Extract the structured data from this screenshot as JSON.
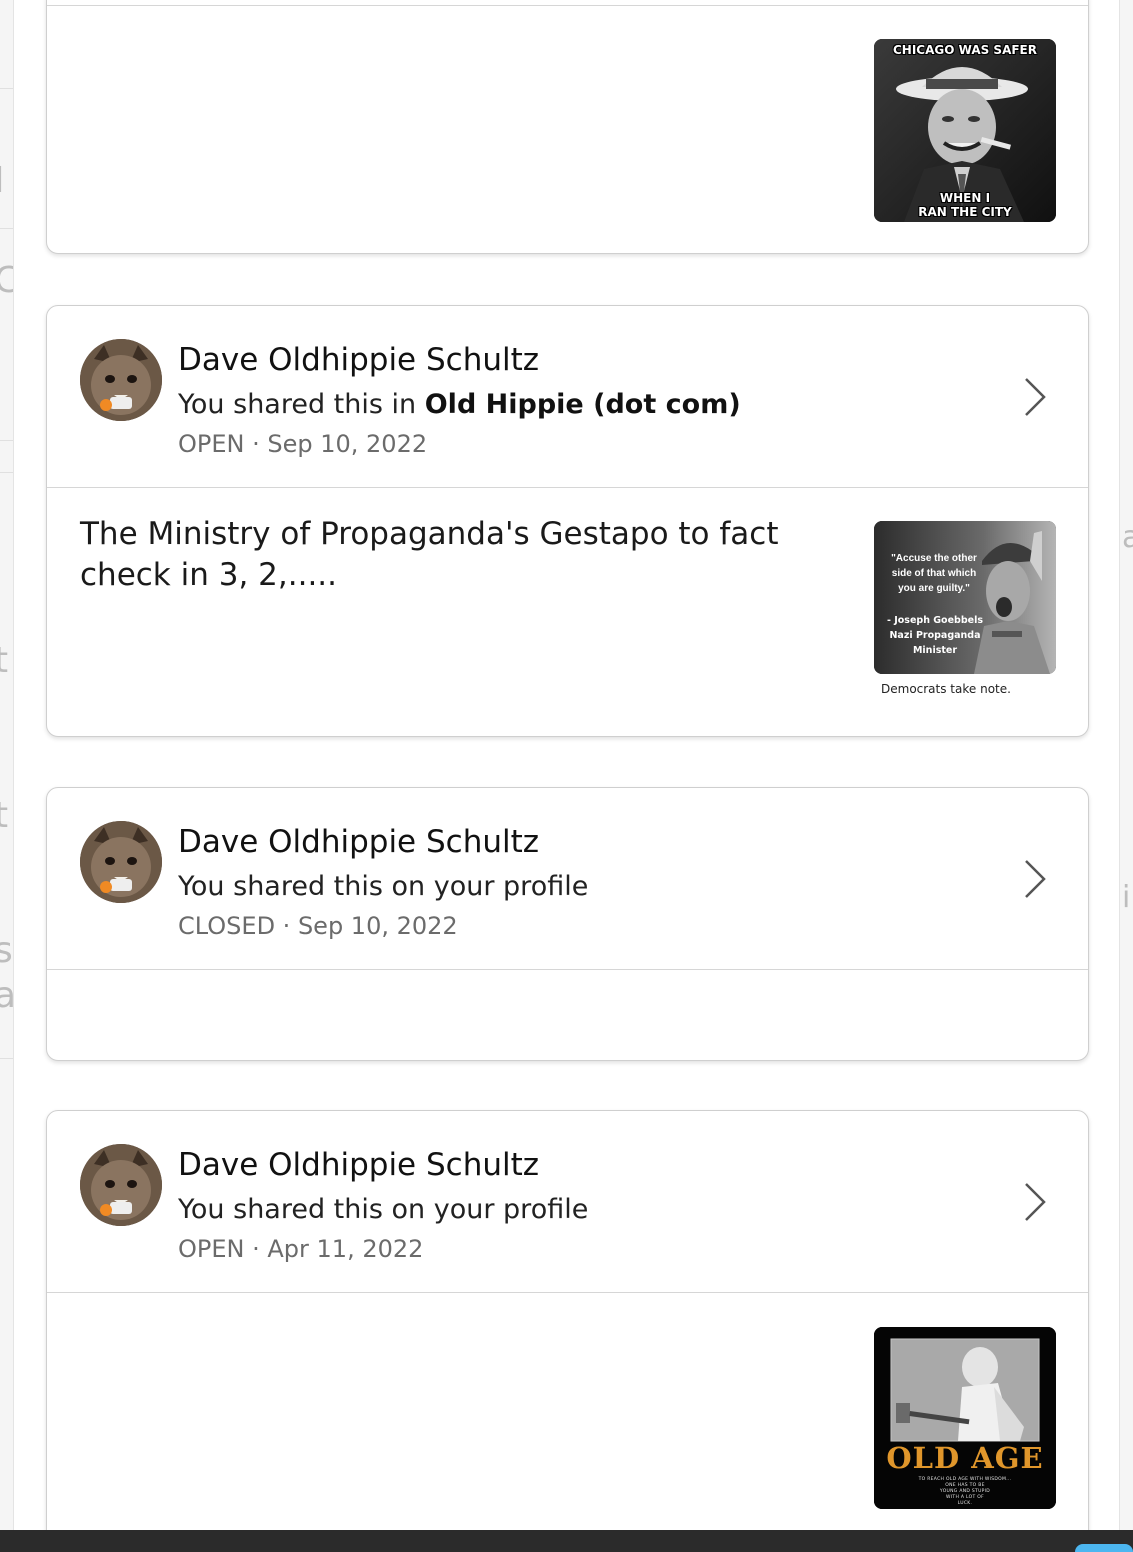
{
  "background_ghost": {
    "left_glyphs": [
      "I",
      "C",
      "t",
      "t",
      "st",
      "a"
    ],
    "right_glyphs": [
      "a",
      "i"
    ]
  },
  "posts": [
    {
      "id": "post-1",
      "author": "",
      "shared_prefix": "",
      "shared_target": "",
      "status": "",
      "date": "",
      "text": "",
      "image": {
        "top_text": "CHICAGO WAS SAFER",
        "bottom_text_1": "WHEN I",
        "bottom_text_2": "RAN THE CITY"
      }
    },
    {
      "id": "post-2",
      "author": "Dave Oldhippie Schultz",
      "shared_prefix": "You shared this in ",
      "shared_target": "Old Hippie (dot com)",
      "status": "OPEN",
      "separator": " · ",
      "date": "Sep 10, 2022",
      "text": "The Ministry of Propaganda's Gestapo to fact check in 3, 2,.....",
      "image": {
        "quote_1": "\"Accuse the other",
        "quote_2": "side of that which",
        "quote_3": "you are guilty.\"",
        "attrib_1": "- Joseph Goebbels",
        "attrib_2": "Nazi Propaganda Minister",
        "caption": "Democrats take note."
      }
    },
    {
      "id": "post-3",
      "author": "Dave Oldhippie Schultz",
      "shared_prefix": "You shared this on your profile",
      "shared_target": "",
      "status": "CLOSED",
      "separator": " · ",
      "date": "Sep 10, 2022",
      "text": ""
    },
    {
      "id": "post-4",
      "author": "Dave Oldhippie Schultz",
      "shared_prefix": "You shared this on your profile",
      "shared_target": "",
      "status": "OPEN",
      "separator": " · ",
      "date": "Apr 11, 2022",
      "text": "",
      "image": {
        "title": "OLD AGE",
        "sub_1": "TO REACH OLD AGE WITH WISDOM...",
        "sub_2": "ONE HAS TO BE",
        "sub_3": "YOUNG AND STUPID",
        "sub_4": "WITH A LOT OF",
        "sub_5": "LUCK."
      }
    }
  ],
  "icons": {
    "chevron": "chevron-right-icon",
    "avatar": "cat-avatar"
  },
  "colors": {
    "meta_gray": "#6b6b6b",
    "card_border": "#cfcfcf",
    "old_age_orange": "#e0962b"
  }
}
